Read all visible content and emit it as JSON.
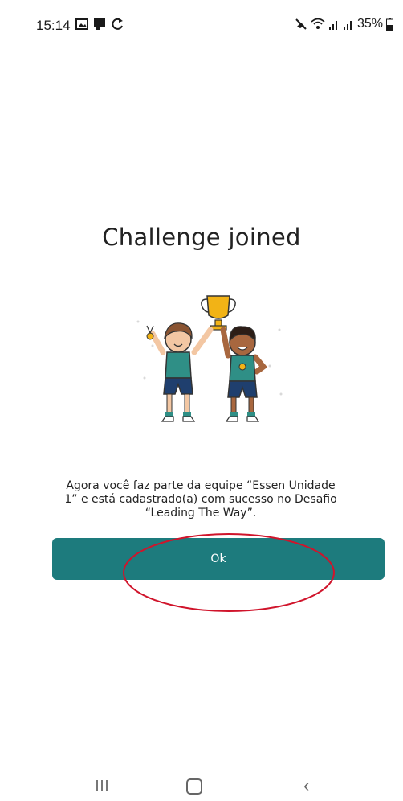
{
  "status_bar": {
    "time": "15:14",
    "left_icons": [
      "gallery-icon",
      "notification-icon",
      "sync-icon"
    ],
    "right_icons": [
      "mute-icon",
      "wifi-icon",
      "signal-icon",
      "signal-icon-2",
      "battery-icon"
    ],
    "battery": "35%"
  },
  "dialog": {
    "title": "Challenge joined",
    "message": "Agora você faz parte da equipe “Essen Unidade 1” e está cadastrado(a) com sucesso no Desafio “Leading The Way”.",
    "ok_label": "Ok"
  },
  "colors": {
    "button": "#1d7b7d",
    "annotation": "#d0142b",
    "trophy": "#f2b316",
    "shirt": "#2f8f86",
    "shorts": "#1f3f6e"
  },
  "nav_bar": {
    "icons": [
      "recents-icon",
      "home-icon",
      "back-icon"
    ]
  }
}
